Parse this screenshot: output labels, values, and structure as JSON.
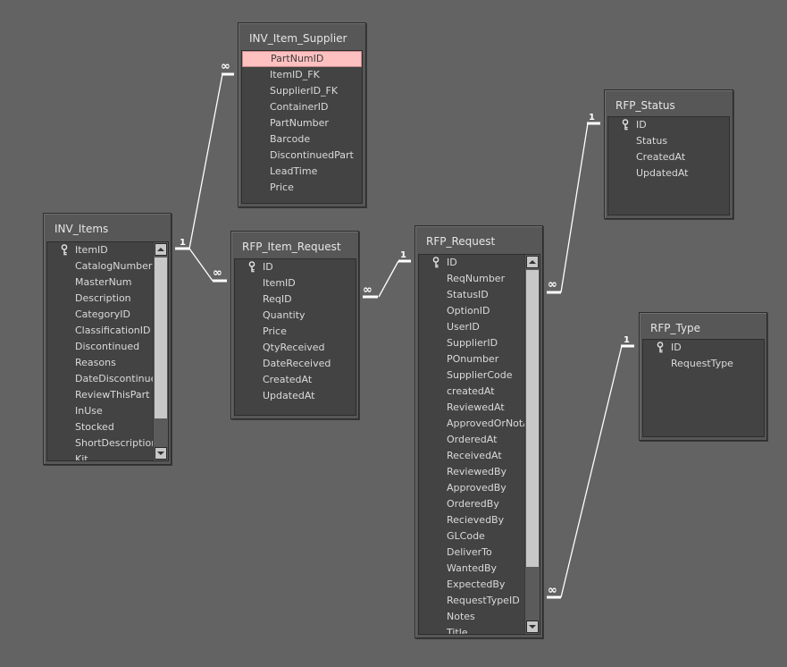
{
  "tables": {
    "inv_item_supplier": {
      "title": "INV_Item_Supplier",
      "fields": [
        "PartNumID",
        "ItemID_FK",
        "SupplierID_FK",
        "ContainerID",
        "PartNumber",
        "Barcode",
        "DiscontinuedPart",
        "LeadTime",
        "Price"
      ]
    },
    "rfp_status": {
      "title": "RFP_Status",
      "fields": [
        "ID",
        "Status",
        "CreatedAt",
        "UpdatedAt"
      ]
    },
    "inv_items": {
      "title": "INV_Items",
      "fields": [
        "ItemID",
        "CatalogNumber",
        "MasterNum",
        "Description",
        "CategoryID",
        "ClassificationID",
        "Discontinued",
        "Reasons",
        "DateDiscontinue",
        "ReviewThisPart",
        "InUse",
        "Stocked",
        "ShortDescription",
        "Kit"
      ]
    },
    "rfp_item_request": {
      "title": "RFP_Item_Request",
      "fields": [
        "ID",
        "ItemID",
        "ReqID",
        "Quantity",
        "Price",
        "QtyReceived",
        "DateReceived",
        "CreatedAt",
        "UpdatedAt"
      ]
    },
    "rfp_request": {
      "title": "RFP_Request",
      "fields": [
        "ID",
        "ReqNumber",
        "StatusID",
        "OptionID",
        "UserID",
        "SupplierID",
        "POnumber",
        "SupplierCode",
        "createdAt",
        "ReviewedAt",
        "ApprovedOrNotAt",
        "OrderedAt",
        "ReceivedAt",
        "ReviewedBy",
        "ApprovedBy",
        "OrderedBy",
        "RecievedBy",
        "GLCode",
        "DeliverTo",
        "WantedBy",
        "ExpectedBy",
        "RequestTypeID",
        "Notes",
        "Title"
      ]
    },
    "rfp_type": {
      "title": "RFP_Type",
      "fields": [
        "ID",
        "RequestType"
      ]
    }
  },
  "relationships": [
    {
      "one_label": "1",
      "many_label": "∞"
    },
    {
      "one_label": "1",
      "many_label": "∞"
    },
    {
      "one_label": "1",
      "many_label": "∞"
    },
    {
      "one_label": "1",
      "many_label": "∞"
    },
    {
      "one_label": "1",
      "many_label": "∞"
    }
  ],
  "colors": {
    "background": "#636363",
    "table_body": "#434343",
    "selected_field": "#ffc0c0"
  }
}
